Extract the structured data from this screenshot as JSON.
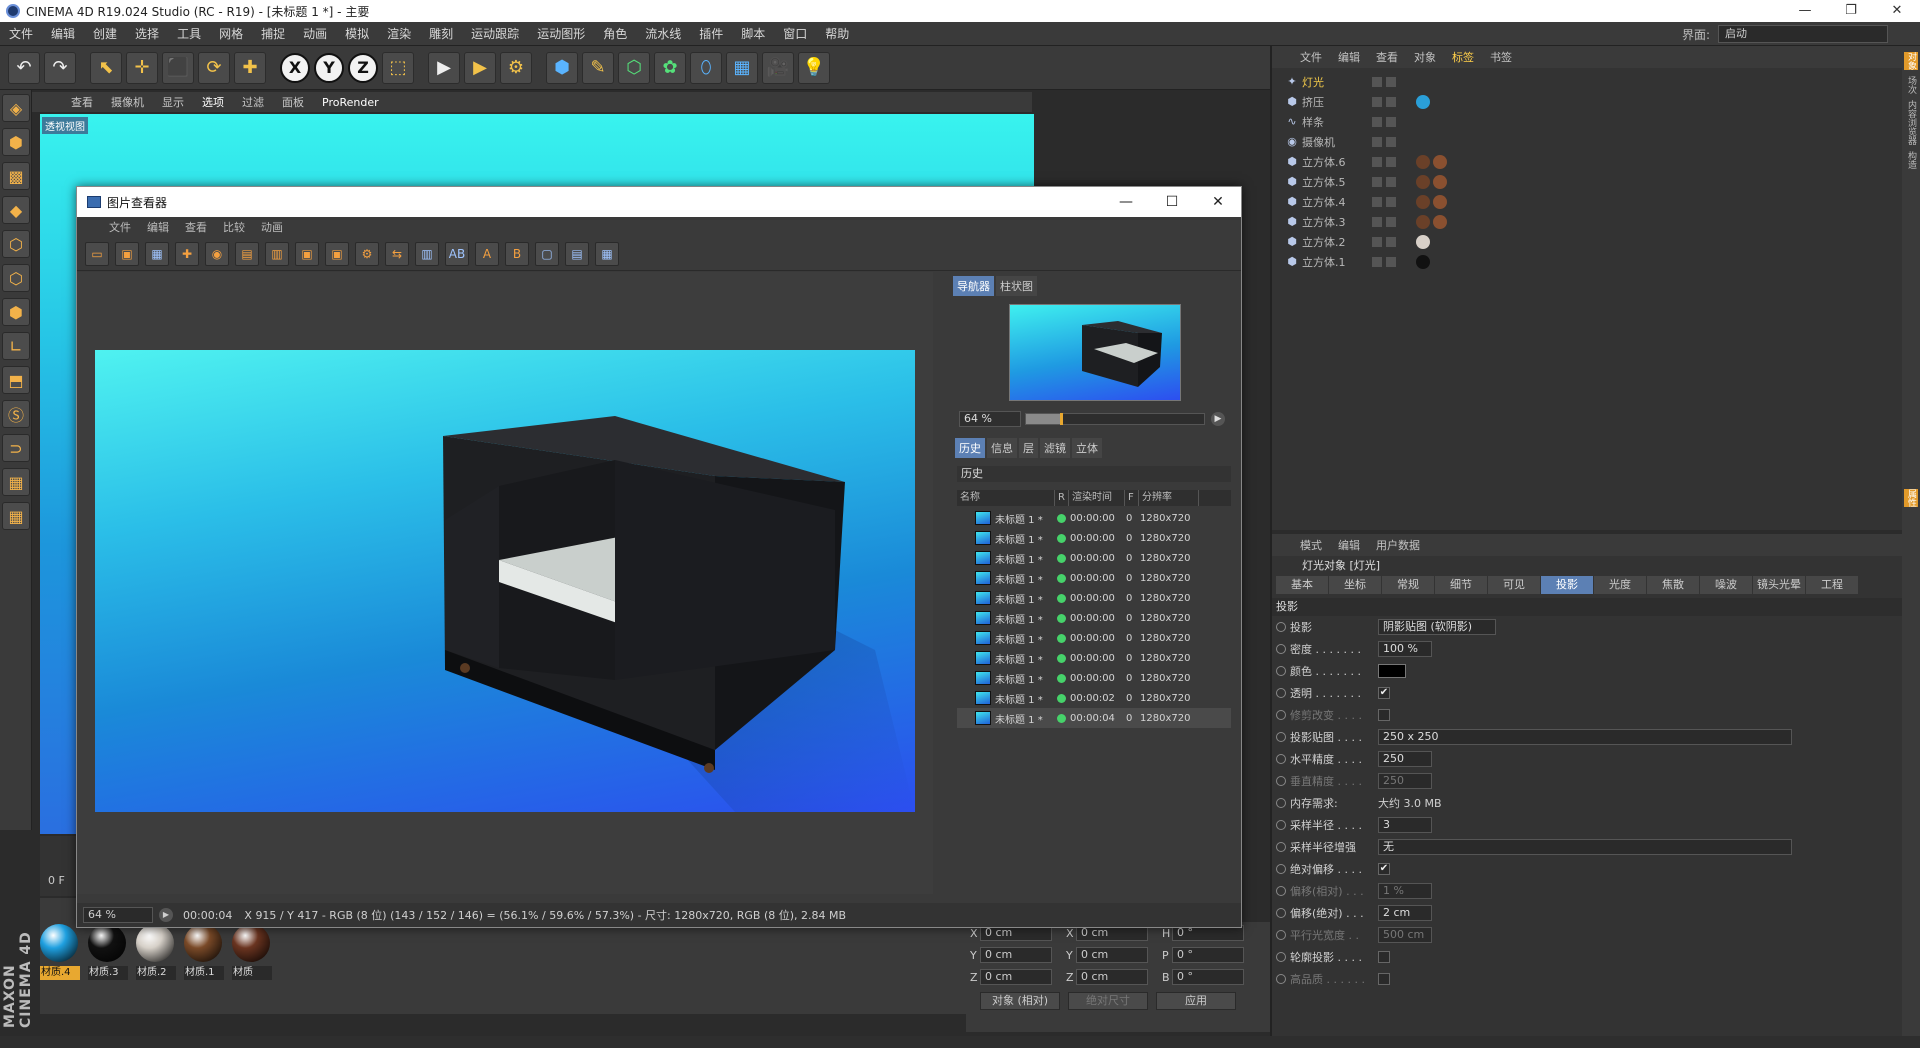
{
  "window": {
    "title": "CINEMA 4D R19.024 Studio (RC - R19) - [未标题 1 *] - 主要",
    "controls": [
      "—",
      "❐",
      "✕"
    ]
  },
  "menubar": {
    "items": [
      "文件",
      "编辑",
      "创建",
      "选择",
      "工具",
      "网格",
      "捕捉",
      "动画",
      "模拟",
      "渲染",
      "雕刻",
      "运动跟踪",
      "运动图形",
      "角色",
      "流水线",
      "插件",
      "脚本",
      "窗口",
      "帮助"
    ],
    "layout_label": "界面:",
    "layout_value": "启动"
  },
  "toolbar": {
    "undo": "↶",
    "redo": "↷",
    "select": "⬉",
    "move": "✛",
    "scale": "⬛",
    "rotate": "⟳",
    "live": "✚",
    "x": "X",
    "y": "Y",
    "z": "Z",
    "coord": "⬚",
    "render_view": "▶",
    "render_pv": "▶",
    "render_settings": "⚙",
    "cube": "⬢",
    "pen": "✎",
    "subdivide": "⬡",
    "array": "✿",
    "deform": "⬯",
    "floor": "▦",
    "camera": "🎥",
    "light": "💡"
  },
  "viewport": {
    "menu": [
      "查看",
      "摄像机",
      "显示",
      "选项",
      "过滤",
      "面板",
      "ProRender"
    ],
    "active_menu": "选项",
    "label": "透视视图",
    "frame_label": "0 F"
  },
  "picture_viewer": {
    "title": "图片查看器",
    "controls": [
      "—",
      "☐",
      "✕"
    ],
    "menu": [
      "文件",
      "编辑",
      "查看",
      "比较",
      "动画"
    ],
    "side_tabs": [
      "导航器",
      "柱状图"
    ],
    "zoom": "64 %",
    "zoom_fraction": 0.64,
    "history_tabs": [
      "历史",
      "信息",
      "层",
      "滤镜",
      "立体"
    ],
    "history_title": "历史",
    "history_columns": [
      "名称",
      "R",
      "渲染时间",
      "F",
      "分辨率"
    ],
    "history_rows": [
      {
        "name": "未标题 1 *",
        "time": "00:00:00",
        "f": "0",
        "res": "1280x720"
      },
      {
        "name": "未标题 1 *",
        "time": "00:00:00",
        "f": "0",
        "res": "1280x720"
      },
      {
        "name": "未标题 1 *",
        "time": "00:00:00",
        "f": "0",
        "res": "1280x720"
      },
      {
        "name": "未标题 1 *",
        "time": "00:00:00",
        "f": "0",
        "res": "1280x720"
      },
      {
        "name": "未标题 1 *",
        "time": "00:00:00",
        "f": "0",
        "res": "1280x720"
      },
      {
        "name": "未标题 1 *",
        "time": "00:00:00",
        "f": "0",
        "res": "1280x720"
      },
      {
        "name": "未标题 1 *",
        "time": "00:00:00",
        "f": "0",
        "res": "1280x720"
      },
      {
        "name": "未标题 1 *",
        "time": "00:00:00",
        "f": "0",
        "res": "1280x720"
      },
      {
        "name": "未标题 1 *",
        "time": "00:00:00",
        "f": "0",
        "res": "1280x720"
      },
      {
        "name": "未标题 1 *",
        "time": "00:00:02",
        "f": "0",
        "res": "1280x720"
      },
      {
        "name": "未标题 1 *",
        "time": "00:00:04",
        "f": "0",
        "res": "1280x720"
      }
    ],
    "status_zoom": "64 %",
    "status_time": "00:00:04",
    "status_info": "X 915 / Y 417 - RGB (8 位) (143 / 152 / 146) = (56.1% / 59.6% / 57.3%) - 尺寸: 1280x720, RGB (8 位), 2.84 MB"
  },
  "object_manager": {
    "menu": [
      "文件",
      "编辑",
      "查看",
      "对象",
      "标签",
      "书签"
    ],
    "active_menu": "标签",
    "objects": [
      {
        "name": "灯光",
        "icon": "✦",
        "highlight": true,
        "tags": []
      },
      {
        "name": "挤压",
        "icon": "⬢",
        "highlight": false,
        "tags": [
          "#2a9fd8"
        ]
      },
      {
        "name": "样条",
        "icon": "∿",
        "highlight": false,
        "tags": []
      },
      {
        "name": "摄像机",
        "icon": "◉",
        "highlight": false,
        "tags": []
      },
      {
        "name": "立方体.6",
        "icon": "⬢",
        "highlight": false,
        "tags": [
          "#6a4028",
          "#8a5030"
        ]
      },
      {
        "name": "立方体.5",
        "icon": "⬢",
        "highlight": false,
        "tags": [
          "#6a4028",
          "#8a5030"
        ]
      },
      {
        "name": "立方体.4",
        "icon": "⬢",
        "highlight": false,
        "tags": [
          "#6a4028",
          "#8a5030"
        ]
      },
      {
        "name": "立方体.3",
        "icon": "⬢",
        "highlight": false,
        "tags": [
          "#6a4028",
          "#8a5030"
        ]
      },
      {
        "name": "立方体.2",
        "icon": "⬢",
        "highlight": false,
        "tags": [
          "#d8d0c8"
        ]
      },
      {
        "name": "立方体.1",
        "icon": "⬢",
        "highlight": false,
        "tags": [
          "#111111"
        ]
      }
    ]
  },
  "right_strip": [
    "对象",
    "场次",
    "内容浏览器",
    "构造"
  ],
  "right_strip_active": "对象",
  "right_strip_bottom": "属性",
  "attribute_manager": {
    "menu": [
      "模式",
      "编辑",
      "用户数据"
    ],
    "object_title": "灯光对象 [灯光]",
    "tabs": [
      "基本",
      "坐标",
      "常规",
      "细节",
      "可见",
      "投影",
      "光度",
      "焦散",
      "噪波",
      "镜头光晕",
      "工程"
    ],
    "active_tab": "投影",
    "section": "投影",
    "rows": [
      {
        "label": "投影",
        "type": "select",
        "value": "阴影贴图 (软阴影)",
        "dim": false
      },
      {
        "label": "密度 . . . . . . .",
        "type": "field",
        "value": "100 %",
        "dim": false
      },
      {
        "label": "颜色 . . . . . . .",
        "type": "swatch",
        "value": "",
        "dim": false
      },
      {
        "label": "透明 . . . . . . .",
        "type": "check",
        "value": "✔",
        "dim": false
      },
      {
        "label": "修剪改变 . . . .",
        "type": "check",
        "value": "",
        "dim": true
      },
      {
        "label": "投影贴图 . . . .",
        "type": "wide",
        "value": "250 x 250",
        "dim": false
      },
      {
        "label": "水平精度 . . . .",
        "type": "field",
        "value": "250",
        "dim": false
      },
      {
        "label": "垂直精度 . . . .",
        "type": "field",
        "value": "250",
        "dim": true
      },
      {
        "label": "内存需求:",
        "type": "text",
        "value": "大约 3.0 MB",
        "dim": false
      },
      {
        "label": "采样半径 . . . .",
        "type": "field",
        "value": "3",
        "dim": false
      },
      {
        "label": "采样半径增强",
        "type": "wide",
        "value": "无",
        "dim": false
      },
      {
        "label": "绝对偏移 . . . .",
        "type": "check",
        "value": "✔",
        "dim": false
      },
      {
        "label": "偏移(相对) . . .",
        "type": "field",
        "value": "1 %",
        "dim": true
      },
      {
        "label": "偏移(绝对) . . .",
        "type": "field",
        "value": "2 cm",
        "dim": false
      },
      {
        "label": "平行光宽度 . .",
        "type": "field",
        "value": "500 cm",
        "dim": true
      },
      {
        "label": "轮廓投影 . . . .",
        "type": "check",
        "value": "",
        "dim": false
      },
      {
        "label": "高品质 . . . . . .",
        "type": "check",
        "value": "",
        "dim": true
      }
    ]
  },
  "materials": [
    {
      "label": "材质.4",
      "color": "#1fa0e0",
      "selected": true
    },
    {
      "label": "材质.3",
      "color": "#111111",
      "selected": false
    },
    {
      "label": "材质.2",
      "color": "#d6d0c8",
      "selected": false
    },
    {
      "label": "材质.1",
      "color": "#7a4a28",
      "selected": false
    },
    {
      "label": "材质",
      "color": "#6a3420",
      "selected": false
    }
  ],
  "coordinates": {
    "rows": [
      {
        "a1": "X",
        "v1": "0 cm",
        "a2": "X",
        "v2": "0 cm",
        "a3": "H",
        "v3": "0 °"
      },
      {
        "a1": "Y",
        "v1": "0 cm",
        "a2": "Y",
        "v2": "0 cm",
        "a3": "P",
        "v3": "0 °"
      },
      {
        "a1": "Z",
        "v1": "0 cm",
        "a2": "Z",
        "v2": "0 cm",
        "a3": "B",
        "v3": "0 °"
      }
    ],
    "mode": "对象 (相对)",
    "size_mode": "绝对尺寸",
    "apply": "应用"
  },
  "brand": "MAXON CINEMA 4D"
}
